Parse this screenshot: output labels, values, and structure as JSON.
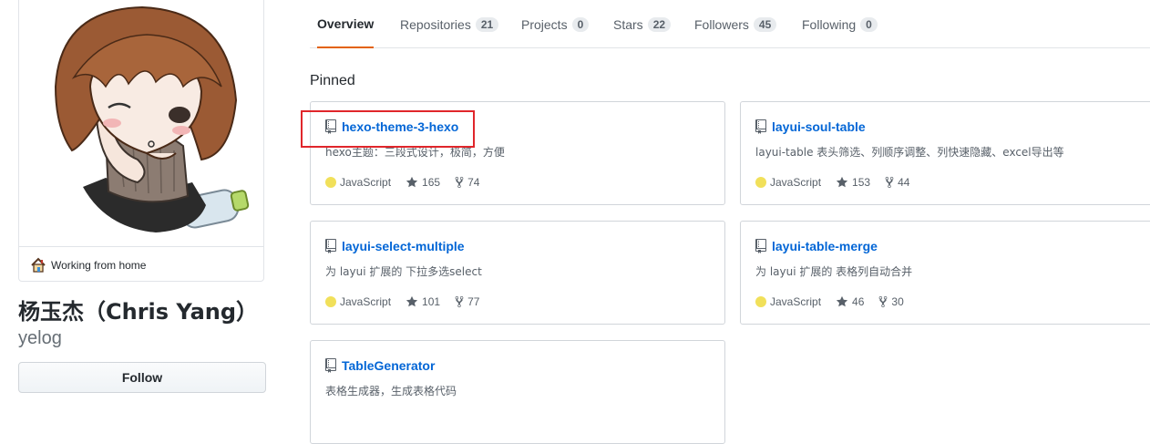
{
  "profile": {
    "status": "Working from home",
    "fullname": "杨玉杰（Chris Yang）",
    "username": "yelog",
    "follow_label": "Follow"
  },
  "tabs": [
    {
      "label": "Overview",
      "count": null,
      "active": true
    },
    {
      "label": "Repositories",
      "count": "21"
    },
    {
      "label": "Projects",
      "count": "0"
    },
    {
      "label": "Stars",
      "count": "22"
    },
    {
      "label": "Followers",
      "count": "45"
    },
    {
      "label": "Following",
      "count": "0"
    }
  ],
  "pinned": {
    "heading": "Pinned",
    "repos": [
      {
        "name": "hexo-theme-3-hexo",
        "desc": "hexo主题：三段式设计，极简，方便",
        "language": "JavaScript",
        "stars": "165",
        "forks": "74"
      },
      {
        "name": "layui-soul-table",
        "desc": "layui-table 表头筛选、列顺序调整、列快速隐藏、excel导出等",
        "language": "JavaScript",
        "stars": "153",
        "forks": "44"
      },
      {
        "name": "layui-select-multiple",
        "desc": "为 layui 扩展的 下拉多选select",
        "language": "JavaScript",
        "stars": "101",
        "forks": "77"
      },
      {
        "name": "layui-table-merge",
        "desc": "为 layui 扩展的 表格列自动合并",
        "language": "JavaScript",
        "stars": "46",
        "forks": "30"
      },
      {
        "name": "TableGenerator",
        "desc": "表格生成器，生成表格代码",
        "language": "",
        "stars": "",
        "forks": ""
      }
    ]
  },
  "colors": {
    "link": "#0366d6",
    "javascript": "#f1e05a",
    "active_tab_underline": "#e36209",
    "highlight": "#e0262b"
  },
  "icons": [
    "house-icon",
    "repo-icon",
    "star-icon",
    "fork-icon"
  ]
}
